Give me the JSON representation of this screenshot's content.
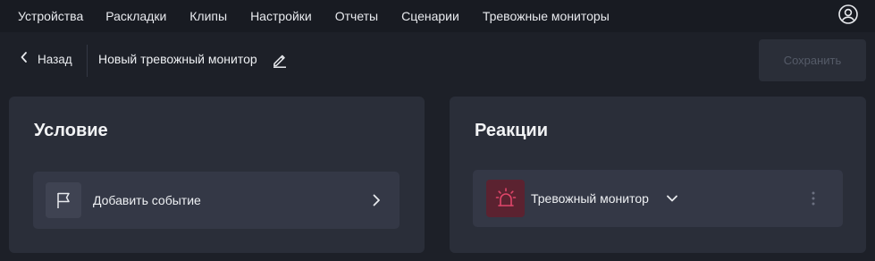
{
  "nav": {
    "items": [
      {
        "label": "Устройства"
      },
      {
        "label": "Раскладки"
      },
      {
        "label": "Клипы"
      },
      {
        "label": "Настройки"
      },
      {
        "label": "Отчеты"
      },
      {
        "label": "Сценарии"
      },
      {
        "label": "Тревожные мониторы"
      }
    ],
    "user_icon": "user-circle-icon"
  },
  "header": {
    "back_label": "Назад",
    "title": "Новый тревожный монитор",
    "save_label": "Сохранить",
    "save_enabled": false
  },
  "condition": {
    "title": "Условие",
    "add_event_label": "Добавить событие",
    "icon": "flag-icon"
  },
  "reactions": {
    "title": "Реакции",
    "items": [
      {
        "label": "Тревожный монитор",
        "icon": "alarm-siren-icon",
        "accent": "#e0466a"
      }
    ]
  },
  "colors": {
    "background": "#1d2028",
    "topbar": "#181b22",
    "card": "#2a2e39",
    "row": "#343846",
    "alarm_accent": "#e0466a"
  }
}
